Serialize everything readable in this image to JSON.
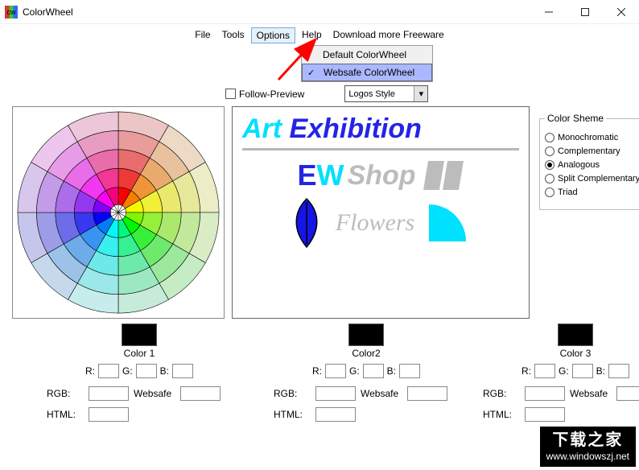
{
  "window": {
    "title": "ColorWheel",
    "icon_text": "cw"
  },
  "menu": {
    "file": "File",
    "tools": "Tools",
    "options": "Options",
    "help": "Help",
    "download": "Download more Freeware"
  },
  "options_dropdown": {
    "default": "Default ColorWheel",
    "websafe": "Websafe ColorWheel"
  },
  "follow_preview": "Follow-Preview",
  "style_combo": "Logos Style",
  "preview": {
    "art": "Art",
    "exhibition": " Exhibition",
    "ew_e": "E",
    "ew_w": "W",
    "shop": "Shop",
    "flowers": "Flowers"
  },
  "scheme": {
    "legend": "Color Sheme",
    "mono": "Monochromatic",
    "comp": "Complementary",
    "analog": "Analogous",
    "split": "Split Complementary",
    "triad": "Triad"
  },
  "colors": {
    "c1": "Color 1",
    "c2": "Color2",
    "c3": "Color 3",
    "r": "R:",
    "g": "G:",
    "b": "B:",
    "rgb": "RGB:",
    "websafe": "Websafe",
    "html": "HTML:"
  },
  "watermark": {
    "line1": "下载之家",
    "line2": "www.windowszj.net"
  }
}
